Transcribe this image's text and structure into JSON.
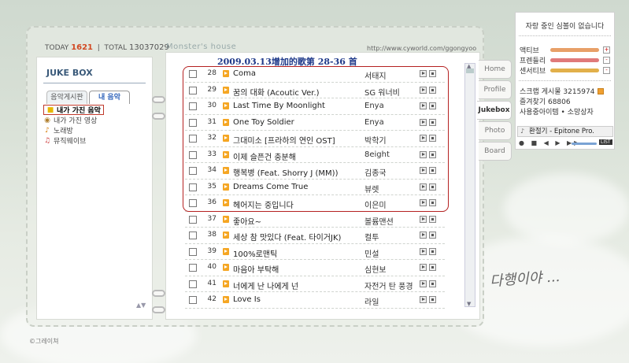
{
  "header": {
    "today_label": "TODAY",
    "today_value": "1621",
    "separator": "|",
    "total_label": "TOTAL",
    "total_value": "13037029",
    "home_title": "Monster's house",
    "url": "http://www.cyworld.com/ggongyoo"
  },
  "jukebox": {
    "title": "JUKE BOX",
    "tabs": [
      "음악게시판",
      "내 음악"
    ],
    "tree": [
      {
        "label": "내가 가진 음악",
        "icon": "folder-icon",
        "selected": true
      },
      {
        "label": "내가 가진 영상",
        "icon": "video-icon",
        "selected": false
      },
      {
        "label": "노래방",
        "icon": "mic-icon",
        "selected": false
      },
      {
        "label": "뮤직웨이브",
        "icon": "music-icon",
        "selected": false
      }
    ]
  },
  "list": {
    "update_title": "2009.03.13增加的歌第 28-36 首",
    "songs": [
      {
        "no": "28",
        "title": "Coma",
        "artist": "서태지"
      },
      {
        "no": "29",
        "title": "꿈의 대화 (Acoutic Ver.)",
        "artist": "SG 워너비"
      },
      {
        "no": "30",
        "title": "Last Time By Moonlight",
        "artist": "Enya"
      },
      {
        "no": "31",
        "title": "One Toy Soldier",
        "artist": "Enya"
      },
      {
        "no": "32",
        "title": "그대미소 [프라하의 연인 OST]",
        "artist": "박학기"
      },
      {
        "no": "33",
        "title": "이제 슬픈건 충분해",
        "artist": "8eight"
      },
      {
        "no": "34",
        "title": "행복병 (Feat. Shorry J (MM))",
        "artist": "김종국"
      },
      {
        "no": "35",
        "title": "Dreams Come True",
        "artist": "뷰렛"
      },
      {
        "no": "36",
        "title": "헤어지는 중입니다",
        "artist": "이은미"
      },
      {
        "no": "37",
        "title": "좋아요~",
        "artist": "볼륨맨션"
      },
      {
        "no": "38",
        "title": "세상 참 맛있다 (Feat. 타이거JK)",
        "artist": "컬투"
      },
      {
        "no": "39",
        "title": "100%로맨틱",
        "artist": "민설"
      },
      {
        "no": "40",
        "title": "마음아 부탁해",
        "artist": "심현보"
      },
      {
        "no": "41",
        "title": "너에게 난 나에게 넌",
        "artist": "자전거 탄 풍경"
      },
      {
        "no": "42",
        "title": "Love Is",
        "artist": "라일"
      }
    ]
  },
  "side_tabs": [
    {
      "label": "Home",
      "active": false
    },
    {
      "label": "Profile",
      "active": false
    },
    {
      "label": "Jukebox",
      "active": true
    },
    {
      "label": "Photo",
      "active": false
    },
    {
      "label": "Board",
      "active": false
    }
  ],
  "status": {
    "message": "자랑 중인 심볼이 없습니다",
    "stats": [
      {
        "label": "액티브",
        "color": "#e8a068",
        "sign": "+"
      },
      {
        "label": "프렌들리",
        "color": "#e07a7a",
        "sign": "-"
      },
      {
        "label": "센서티브",
        "color": "#e2b04a",
        "sign": "-"
      }
    ],
    "scrap": "스크랩 게시물 3215974",
    "favorite": "즐겨찾기 68806",
    "items": "사용중아이템 • 소망상자"
  },
  "player": {
    "now_playing": "환절기 - Epitone Pro.",
    "controls": "● ■ ◀ ▶ ▶▶",
    "list_label": "LIST"
  },
  "signature": "다행이야 ...",
  "copyright": "©그레이쳐"
}
